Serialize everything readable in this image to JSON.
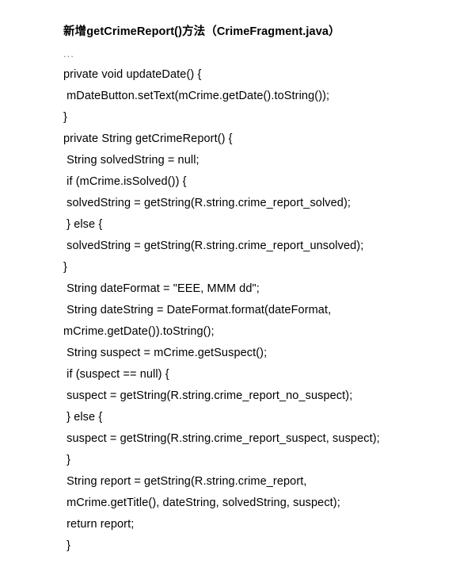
{
  "title": {
    "prefix": "新增getCrimeReport()方法（CrimeFragment.java）"
  },
  "code": {
    "ellipsis": "...",
    "lines": [
      "private void updateDate() {",
      " mDateButton.setText(mCrime.getDate().toString());",
      "}",
      "private String getCrimeReport() {",
      " String solvedString = null;",
      " if (mCrime.isSolved()) {",
      " solvedString = getString(R.string.crime_report_solved);",
      " } else {",
      " solvedString = getString(R.string.crime_report_unsolved);",
      "}",
      " String dateFormat = \"EEE, MMM dd\";",
      " String dateString = DateFormat.format(dateFormat,",
      "mCrime.getDate()).toString();",
      " String suspect = mCrime.getSuspect();",
      " if (suspect == null) {",
      " suspect = getString(R.string.crime_report_no_suspect);",
      " } else {",
      " suspect = getString(R.string.crime_report_suspect, suspect);",
      " }",
      " String report = getString(R.string.crime_report,",
      " mCrime.getTitle(), dateString, solvedString, suspect);",
      " return report;",
      " }"
    ]
  }
}
